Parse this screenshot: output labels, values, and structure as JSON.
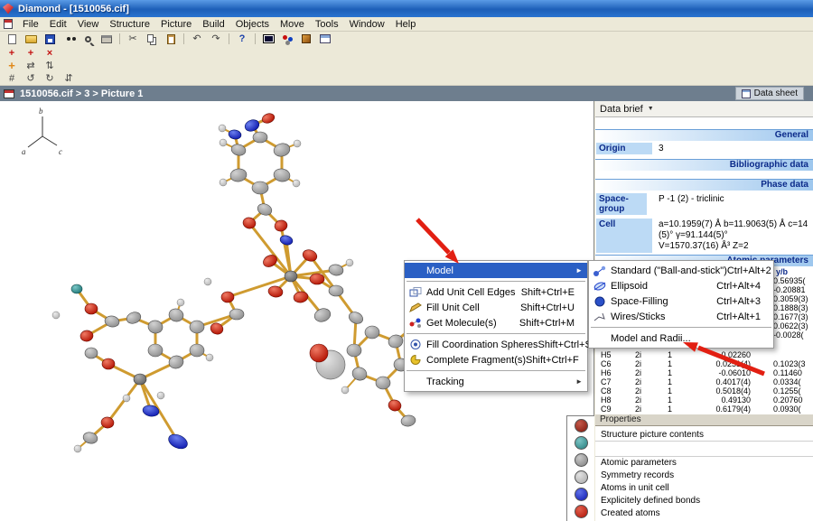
{
  "window": {
    "title": "Diamond - [1510056.cif]"
  },
  "menu_bar": {
    "items": [
      "File",
      "Edit",
      "View",
      "Structure",
      "Picture",
      "Build",
      "Objects",
      "Move",
      "Tools",
      "Window",
      "Help"
    ]
  },
  "toolbar_glyphs": {
    "cut": "✂",
    "undo": "↶",
    "redo": "↷",
    "help": "?",
    "add": "+",
    "edit": "+",
    "del": "×",
    "move": "+",
    "shift_h": "⇄",
    "shift_v": "⇅",
    "rot_ccw": "↺",
    "rot_cw": "↻",
    "rot_ud": "⇵",
    "grid": "#"
  },
  "breadcrumb": {
    "path": "1510056.cif > 3 > Picture 1",
    "data_sheet_label": "Data sheet"
  },
  "axes": {
    "a": "a",
    "b": "b",
    "c": "c"
  },
  "context_menu": {
    "model": {
      "label": "Model"
    },
    "add_unit_cell_edges": {
      "label": "Add Unit Cell Edges",
      "shortcut": "Shift+Ctrl+E"
    },
    "fill_unit_cell": {
      "label": "Fill Unit Cell",
      "shortcut": "Shift+Ctrl+U"
    },
    "get_molecules": {
      "label": "Get Molecule(s)",
      "shortcut": "Shift+Ctrl+M"
    },
    "fill_coordination_spheres": {
      "label": "Fill Coordination Spheres",
      "shortcut": "Shift+Ctrl+S"
    },
    "complete_fragments": {
      "label": "Complete Fragment(s)",
      "shortcut": "Shift+Ctrl+F"
    },
    "tracking": {
      "label": "Tracking"
    }
  },
  "model_submenu": {
    "standard": {
      "label": "Standard (\"Ball-and-stick\")",
      "shortcut": "Ctrl+Alt+2"
    },
    "ellipsoid": {
      "label": "Ellipsoid",
      "shortcut": "Ctrl+Alt+4"
    },
    "space_filling": {
      "label": "Space-Filling",
      "shortcut": "Ctrl+Alt+3"
    },
    "wires_sticks": {
      "label": "Wires/Sticks",
      "shortcut": "Ctrl+Alt+1"
    },
    "model_and_radii": {
      "label": "Model and Radii..."
    }
  },
  "data_brief": {
    "title": "Data brief",
    "general_header": "General",
    "origin_label": "Origin",
    "origin_value": "3",
    "bibliographic_header": "Bibliographic data",
    "phase_header": "Phase data",
    "space_group_label": "Space-group",
    "space_group_value": "P -1 (2) - triclinic",
    "cell_label": "Cell",
    "cell_line1": "a=10.1959(7) Å b=11.9063(5) Å c=14",
    "cell_line2": "(5)° γ=91.144(5)°",
    "cell_line3": "V=1570.37(16) Å³ Z=2",
    "atomic_header": "Atomic parameters",
    "yb_header": "y/b",
    "partial_yb_values": [
      "0.56935(",
      "-0.20881",
      "0.3059(3)",
      "0.1888(3)",
      "0.1677(3)",
      "0.0622(3)",
      "-0.0028("
    ],
    "rows": [
      {
        "atom": "H5",
        "site": "2i",
        "occ": "1",
        "xa": "-0.02260",
        "yb": ""
      },
      {
        "atom": "C6",
        "site": "2i",
        "occ": "1",
        "xa": "0.0251(4)",
        "yb": "0.1023(3"
      },
      {
        "atom": "H6",
        "site": "2i",
        "occ": "1",
        "xa": "-0.06010",
        "yb": "0.11460"
      },
      {
        "atom": "C7",
        "site": "2i",
        "occ": "1",
        "xa": "0.4017(4)",
        "yb": "0.0334("
      },
      {
        "atom": "C8",
        "site": "2i",
        "occ": "1",
        "xa": "0.5018(4)",
        "yb": "0.1255("
      },
      {
        "atom": "H8",
        "site": "2i",
        "occ": "1",
        "xa": "0.49130",
        "yb": "0.20760"
      },
      {
        "atom": "C9",
        "site": "2i",
        "occ": "1",
        "xa": "0.6179(4)",
        "yb": "0.0930("
      }
    ]
  },
  "properties_panel": {
    "header": "Properties",
    "contents_label": "Structure picture contents",
    "items": [
      "Atomic parameters",
      "Symmetry records",
      "Atoms in unit cell",
      "Explicitely defined bonds",
      "Created atoms"
    ]
  },
  "legend": {
    "colors": [
      "#7e170c",
      "#247d7d",
      "#7f7f7f",
      "#a8a8a8",
      "#0f17b0",
      "#b01205"
    ]
  },
  "colors": {
    "menu_highlight": "#2a5fc4",
    "bond": "#cf9b30",
    "breadcrumb_bg": "#6e7e8e",
    "arrow_annotation": "#e21f12",
    "section_header_text": "#0b2a8a",
    "label_cell_bg": "#bcdaf5"
  },
  "glyphs": {
    "dropdown": "▼",
    "submenu_arrow": "►"
  }
}
